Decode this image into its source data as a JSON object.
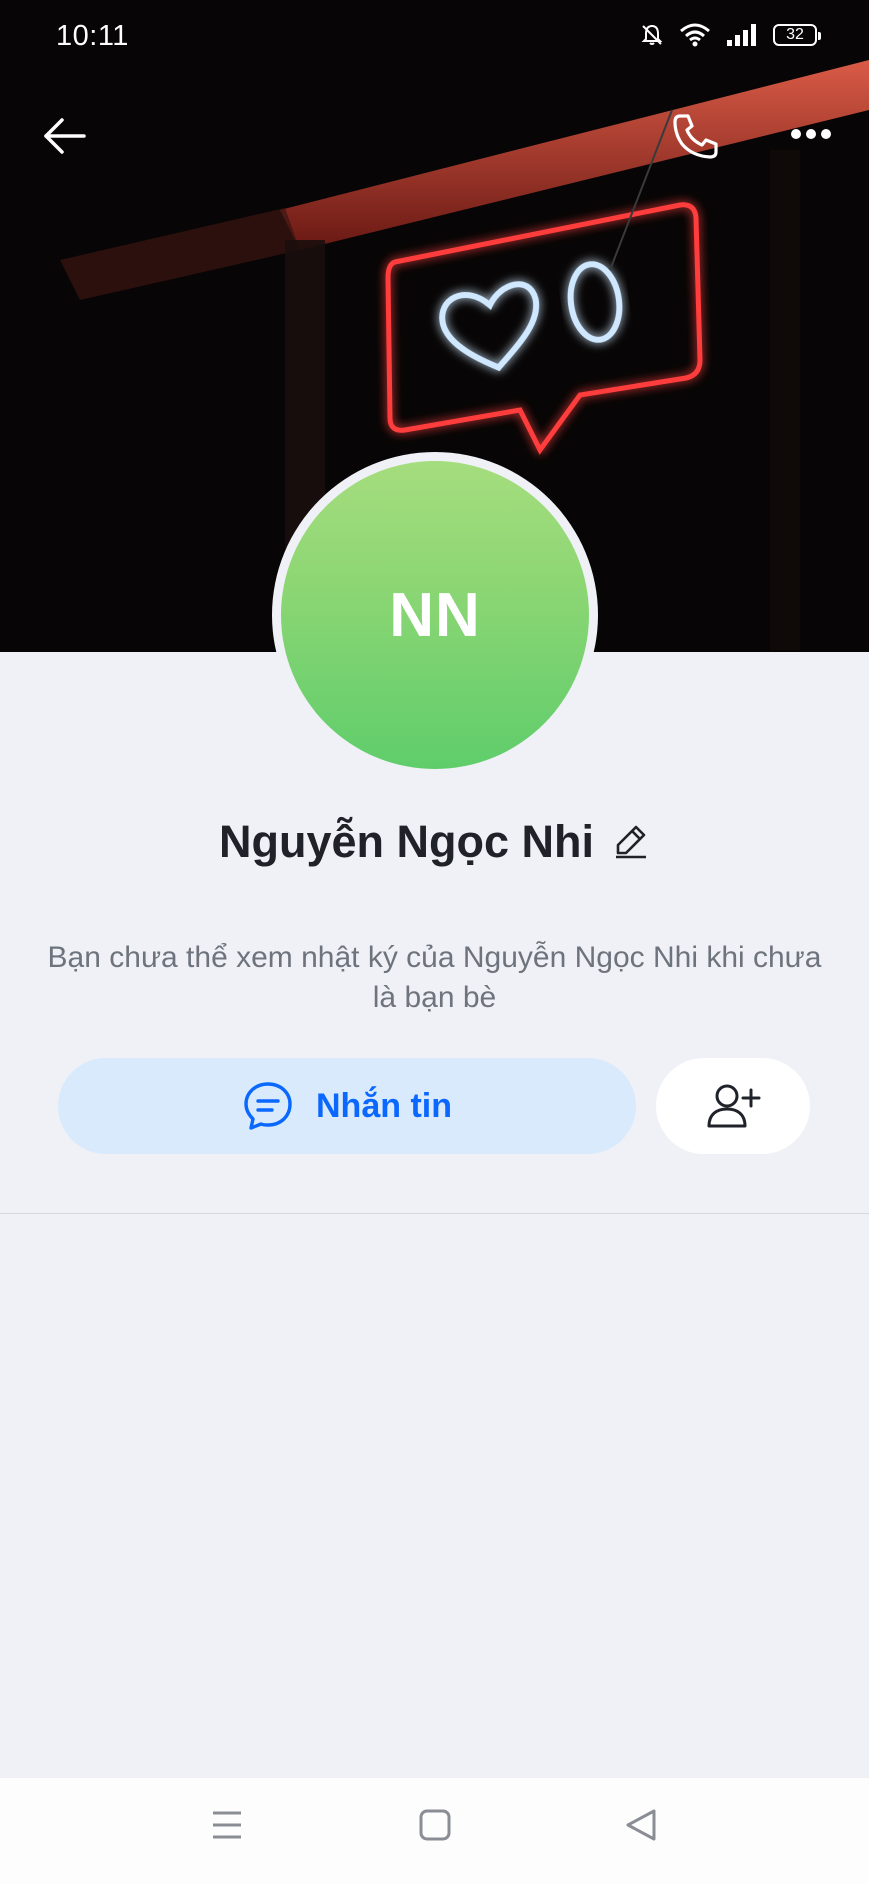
{
  "status_bar": {
    "time": "10:11",
    "battery": "32",
    "icons": [
      "mute-bell-icon",
      "wifi-icon",
      "signal-icon",
      "battery-icon"
    ]
  },
  "cover": {
    "top_actions": [
      "back-arrow-icon",
      "phone-icon",
      "more-icon"
    ]
  },
  "profile": {
    "avatar_initials": "NN",
    "avatar_colors": [
      "#a5dd7e",
      "#5fcd6b"
    ],
    "name": "Nguyễn Ngọc Nhi",
    "note": "Bạn chưa thể xem nhật ký của Nguyễn Ngọc Nhi khi chưa là bạn bè"
  },
  "actions": {
    "message_label": "Nhắn tin",
    "accent": "#0a68ff",
    "add_friend_icon": "add-friend-icon"
  },
  "nav_bar": {
    "icons": [
      "menu-icon",
      "home-icon",
      "back-icon"
    ]
  }
}
